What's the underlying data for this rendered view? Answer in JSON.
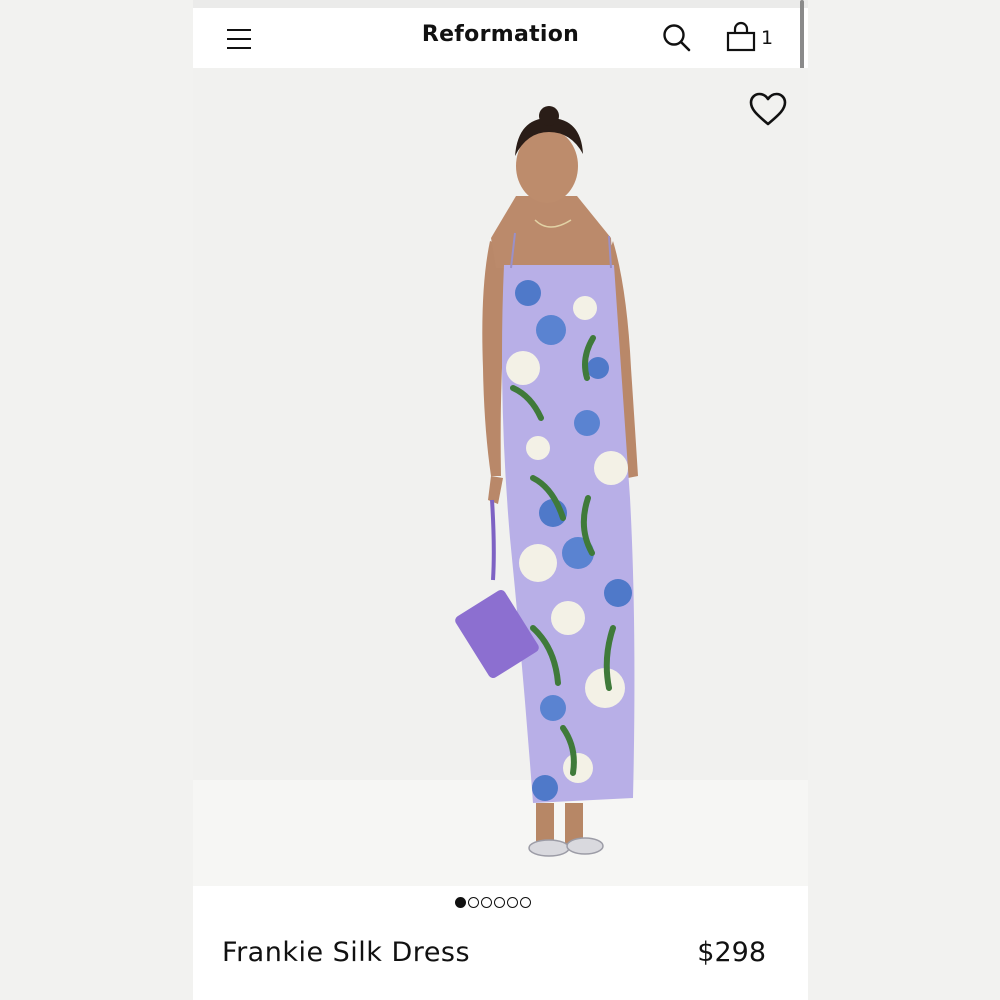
{
  "header": {
    "brand": "Reformation",
    "cart_count": "1",
    "icons": {
      "menu": "hamburger-menu-icon",
      "search": "search-icon",
      "bag": "shopping-bag-icon",
      "wishlist": "heart-icon"
    }
  },
  "gallery": {
    "image_count": 6,
    "active_index": 0
  },
  "product": {
    "name": "Frankie Silk Dress",
    "price": "$298"
  },
  "colors": {
    "dress_base": "#b7aee6",
    "bag": "#8c6fd0",
    "floral_blue": "#4f79c9",
    "floral_cream": "#f3f1e6",
    "leaf_green": "#3f7a3a"
  }
}
